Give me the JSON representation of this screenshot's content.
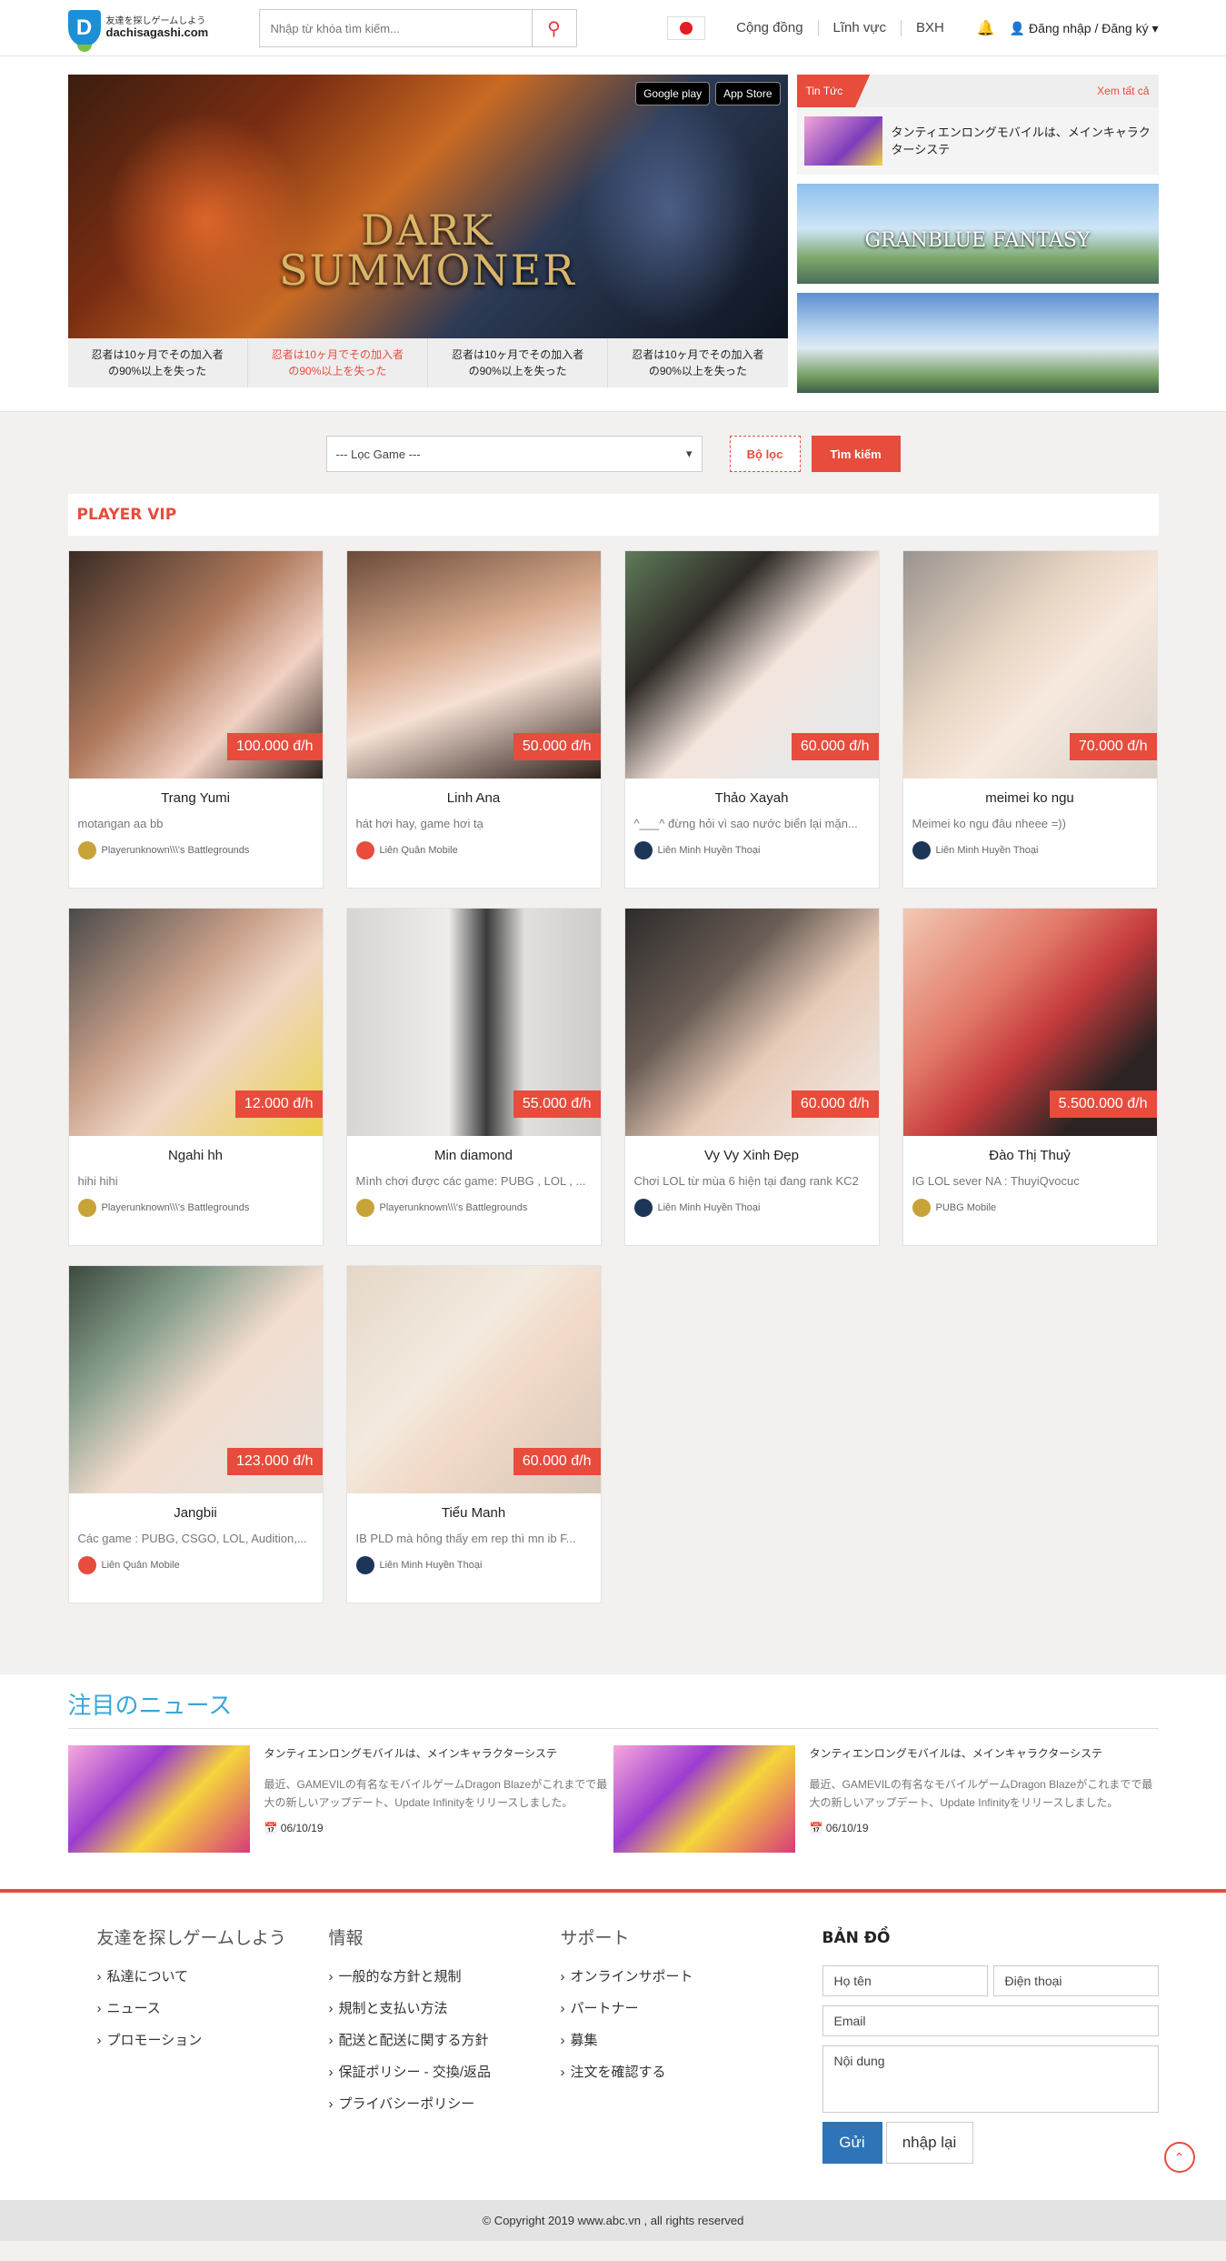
{
  "header": {
    "logo_tag": "友達を探しゲームしよう",
    "logo_domain": "dachisagashi.com",
    "search_placeholder": "Nhập từ khóa tìm kiếm...",
    "nav": [
      "Cộng đồng",
      "Lĩnh vực",
      "BXH"
    ],
    "login": "Đăng nhập / Đăng ký"
  },
  "banner": {
    "title_line1": "DARK",
    "title_line2": "SUMMONER",
    "store1": "Google play",
    "store2": "App Store",
    "tabs": [
      {
        "line1": "忍者は10ヶ月でその加入者",
        "line2": "の90%以上を失った"
      },
      {
        "line1": "忍者は10ヶ月でその加入者",
        "line2": "の90%以上を失った"
      },
      {
        "line1": "忍者は10ヶ月でその加入者",
        "line2": "の90%以上を失った"
      },
      {
        "line1": "忍者は10ヶ月でその加入者",
        "line2": "の90%以上を失った"
      }
    ]
  },
  "side_news": {
    "label": "Tin Tức",
    "more": "Xem tất cả",
    "item": "タンティエンロングモバイルは、メインキャラクターシステ",
    "img_title": "GRANBLUE FANTASY"
  },
  "filter": {
    "select": "--- Lọc Game ---",
    "filter_btn": "Bộ lọc",
    "search_btn": "Tìm kiếm"
  },
  "vip": {
    "title": "PLAYER VIP",
    "players": [
      {
        "name": "Trang Yumi",
        "price": "100.000 đ/h",
        "desc": "motangan aa bb",
        "game": "Playerunknown\\\\\\'s Battlegrounds",
        "icon": "pubg"
      },
      {
        "name": "Linh Ana",
        "price": "50.000 đ/h",
        "desc": "hát hơi hay, game hơi tạ",
        "game": "Liên Quân Mobile",
        "icon": "lqm"
      },
      {
        "name": "Thảo Xayah",
        "price": "60.000 đ/h",
        "desc": "^___^ đừng hỏi vì sao nước biển lại mặn...",
        "game": "Liên Minh Huyền Thoại",
        "icon": "lmht"
      },
      {
        "name": "meimei ko ngu",
        "price": "70.000 đ/h",
        "desc": "Meimei ko ngu đâu nheee =))",
        "game": "Liên Minh Huyền Thoại",
        "icon": "lmht"
      },
      {
        "name": "Ngahi hh",
        "price": "12.000 đ/h",
        "desc": "hihi hihi",
        "game": "Playerunknown\\\\\\'s Battlegrounds",
        "icon": "pubg"
      },
      {
        "name": "Min diamond",
        "price": "55.000 đ/h",
        "desc": "Mình chơi được các game: PUBG , LOL , ...",
        "game": "Playerunknown\\\\\\'s Battlegrounds",
        "icon": "pubg"
      },
      {
        "name": "Vy Vy Xinh Đẹp",
        "price": "60.000 đ/h",
        "desc": "Chơi LOL từ mùa 6 hiện tại đang rank KC2",
        "game": "Liên Minh Huyền Thoại",
        "icon": "lmht"
      },
      {
        "name": "Đào Thị Thuỷ",
        "price": "5.500.000 đ/h",
        "desc": "IG LOL sever NA : ThuyiQvocuc",
        "game": "PUBG Mobile",
        "icon": "pubg"
      },
      {
        "name": "Jangbii",
        "price": "123.000 đ/h",
        "desc": "Các game : PUBG, CSGO, LOL, Audition,...",
        "game": "Liên Quân Mobile",
        "icon": "lqm"
      },
      {
        "name": "Tiểu Manh",
        "price": "60.000 đ/h",
        "desc": "IB PLD mà hông thấy em rep thì mn ib F...",
        "game": "Liên Minh Huyền Thoại",
        "icon": "lmht"
      }
    ]
  },
  "featured": {
    "title": "注目のニュース",
    "items": [
      {
        "title": "タンティエンロングモバイルは、メインキャラクターシステ",
        "text": "最近、GAMEVILの有名なモバイルゲームDragon Blazeがこれまでで最大の新しいアップデート、Update Infinityをリリースしました。",
        "date": "06/10/19"
      },
      {
        "title": "タンティエンロングモバイルは、メインキャラクターシステ",
        "text": "最近、GAMEVILの有名なモバイルゲームDragon Blazeがこれまでで最大の新しいアップデート、Update Infinityをリリースしました。",
        "date": "06/10/19"
      }
    ]
  },
  "footer": {
    "col1": {
      "title": "友達を探しゲームしよう",
      "links": [
        "私達について",
        "ニュース",
        "プロモーション"
      ]
    },
    "col2": {
      "title": "情報",
      "links": [
        "一般的な方針と規制",
        "規制と支払い方法",
        "配送と配送に関する方針",
        "保証ポリシー - 交換/返品",
        "プライバシーポリシー"
      ]
    },
    "col3": {
      "title": "サポート",
      "links": [
        "オンラインサポート",
        "パートナー",
        "募集",
        "注文を確認する"
      ]
    },
    "map": {
      "title": "BẢN ĐỒ",
      "name": "Họ tên",
      "phone": "Điện thoại",
      "email": "Email",
      "content": "Nội dung",
      "send": "Gửi",
      "reset": "nhập lại"
    },
    "copyright": "© Copyright 2019 www.abc.vn , all rights reserved"
  },
  "colors": {
    "accent": "#e74c3c",
    "brand": "#1d8fd6",
    "featured_title": "#3aa6d8",
    "send_button": "#2f73b8"
  }
}
